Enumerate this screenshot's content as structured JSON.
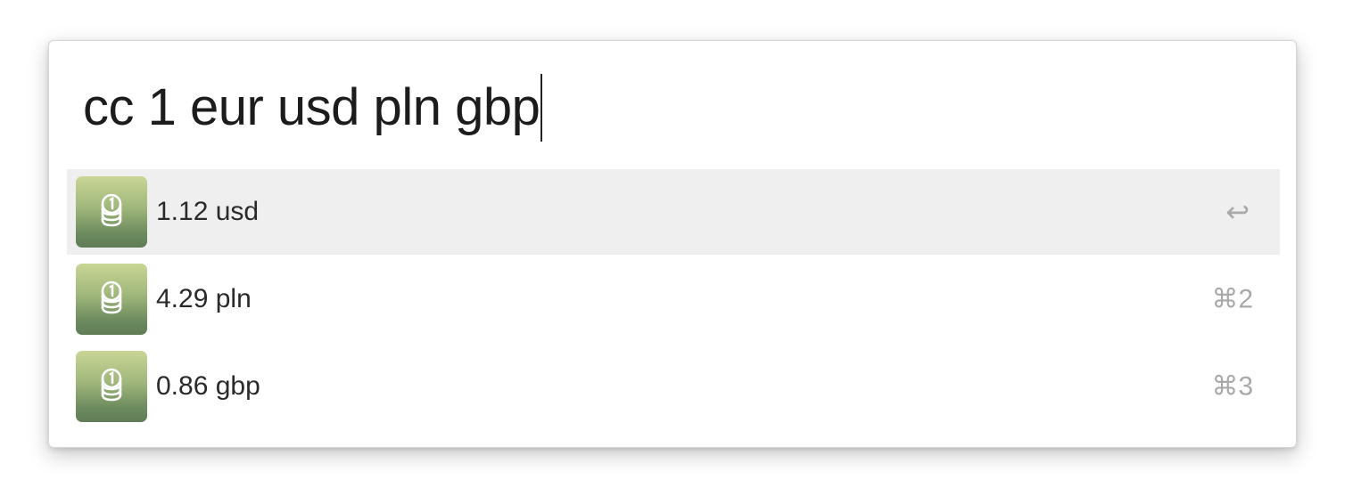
{
  "search": {
    "query": "cc 1 eur usd pln gbp"
  },
  "results": [
    {
      "label": "1.12 usd",
      "shortcut": "↩",
      "icon": "coin-stack-icon",
      "selected": true
    },
    {
      "label": "4.29 pln",
      "shortcut": "⌘2",
      "icon": "coin-stack-icon",
      "selected": false
    },
    {
      "label": "0.86 gbp",
      "shortcut": "⌘3",
      "icon": "coin-stack-icon",
      "selected": false
    }
  ],
  "colors": {
    "selected_row": "#efefef",
    "icon_gradient_top": "#c9d695",
    "icon_gradient_bottom": "#5f7c57",
    "shortcut_text": "#a9a9a9"
  }
}
